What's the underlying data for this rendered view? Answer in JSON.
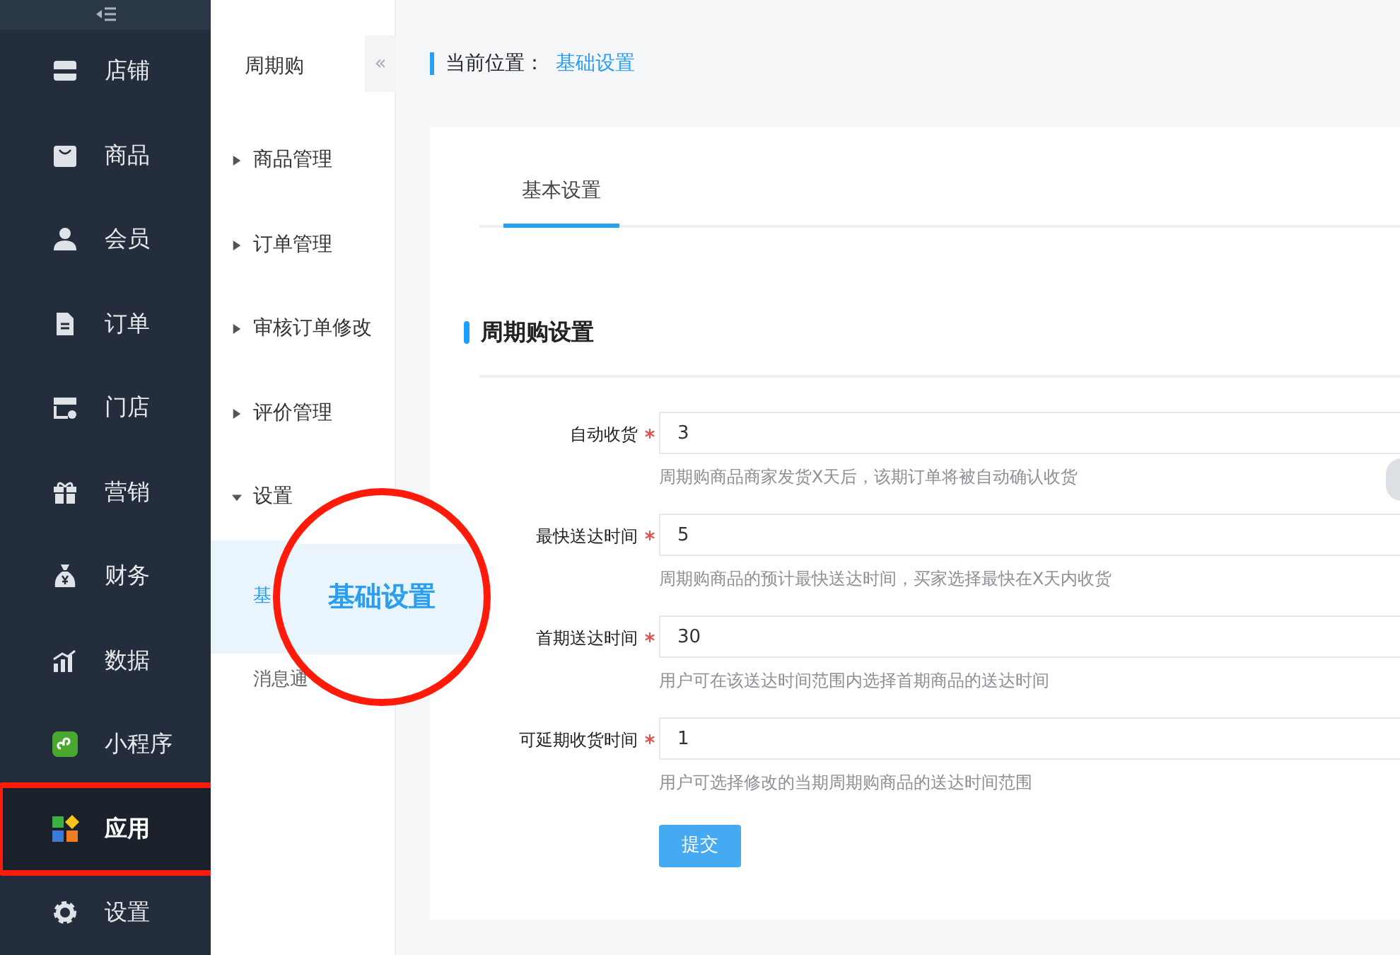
{
  "sidebar": {
    "items": [
      {
        "label": "店铺",
        "kind": "store",
        "selected": false,
        "highlighted": false
      },
      {
        "label": "商品",
        "kind": "bag",
        "selected": false,
        "highlighted": false
      },
      {
        "label": "会员",
        "kind": "user",
        "selected": false,
        "highlighted": false
      },
      {
        "label": "订单",
        "kind": "document",
        "selected": false,
        "highlighted": false
      },
      {
        "label": "门店",
        "kind": "shop",
        "selected": false,
        "highlighted": false
      },
      {
        "label": "营销",
        "kind": "gift",
        "selected": false,
        "highlighted": false
      },
      {
        "label": "财务",
        "kind": "moneybag",
        "selected": false,
        "highlighted": false
      },
      {
        "label": "数据",
        "kind": "chart",
        "selected": false,
        "highlighted": false
      },
      {
        "label": "小程序",
        "kind": "mini",
        "selected": false,
        "highlighted": false
      },
      {
        "label": "应用",
        "kind": "apps",
        "selected": true,
        "highlighted": true
      },
      {
        "label": "设置",
        "kind": "gear",
        "selected": false,
        "highlighted": false
      }
    ]
  },
  "submenu": {
    "title": "周期购",
    "collapse": "«",
    "items": [
      {
        "label": "商品管理",
        "expanded": false
      },
      {
        "label": "订单管理",
        "expanded": false
      },
      {
        "label": "审核订单修改",
        "expanded": false
      },
      {
        "label": "评价管理",
        "expanded": false
      },
      {
        "label": "设置",
        "expanded": true,
        "children": [
          {
            "label": "基",
            "selected": true
          },
          {
            "label": "消息通",
            "selected": false
          }
        ]
      }
    ]
  },
  "callout": {
    "text": "基础设置"
  },
  "breadcrumb": {
    "label": "当前位置：",
    "current": "基础设置"
  },
  "tabs": [
    {
      "label": "基本设置",
      "selected": true
    }
  ],
  "section": {
    "title": "周期购设置"
  },
  "fields": [
    {
      "label": "自动收货",
      "required": true,
      "value": "3",
      "hint": "周期购商品商家发货X天后，该期订单将被自动确认收货"
    },
    {
      "label": "最快送达时间",
      "required": true,
      "value": "5",
      "hint": "周期购商品的预计最快送达时间，买家选择最快在X天内收货"
    },
    {
      "label": "首期送达时间",
      "required": true,
      "value": "30",
      "hint": "用户可在该送达时间范围内选择首期商品的送达时间"
    },
    {
      "label": "可延期收货时间",
      "required": true,
      "value": "1",
      "hint": "用户可选择修改的当期周期购商品的送达时间范围"
    }
  ],
  "submit": "提交"
}
